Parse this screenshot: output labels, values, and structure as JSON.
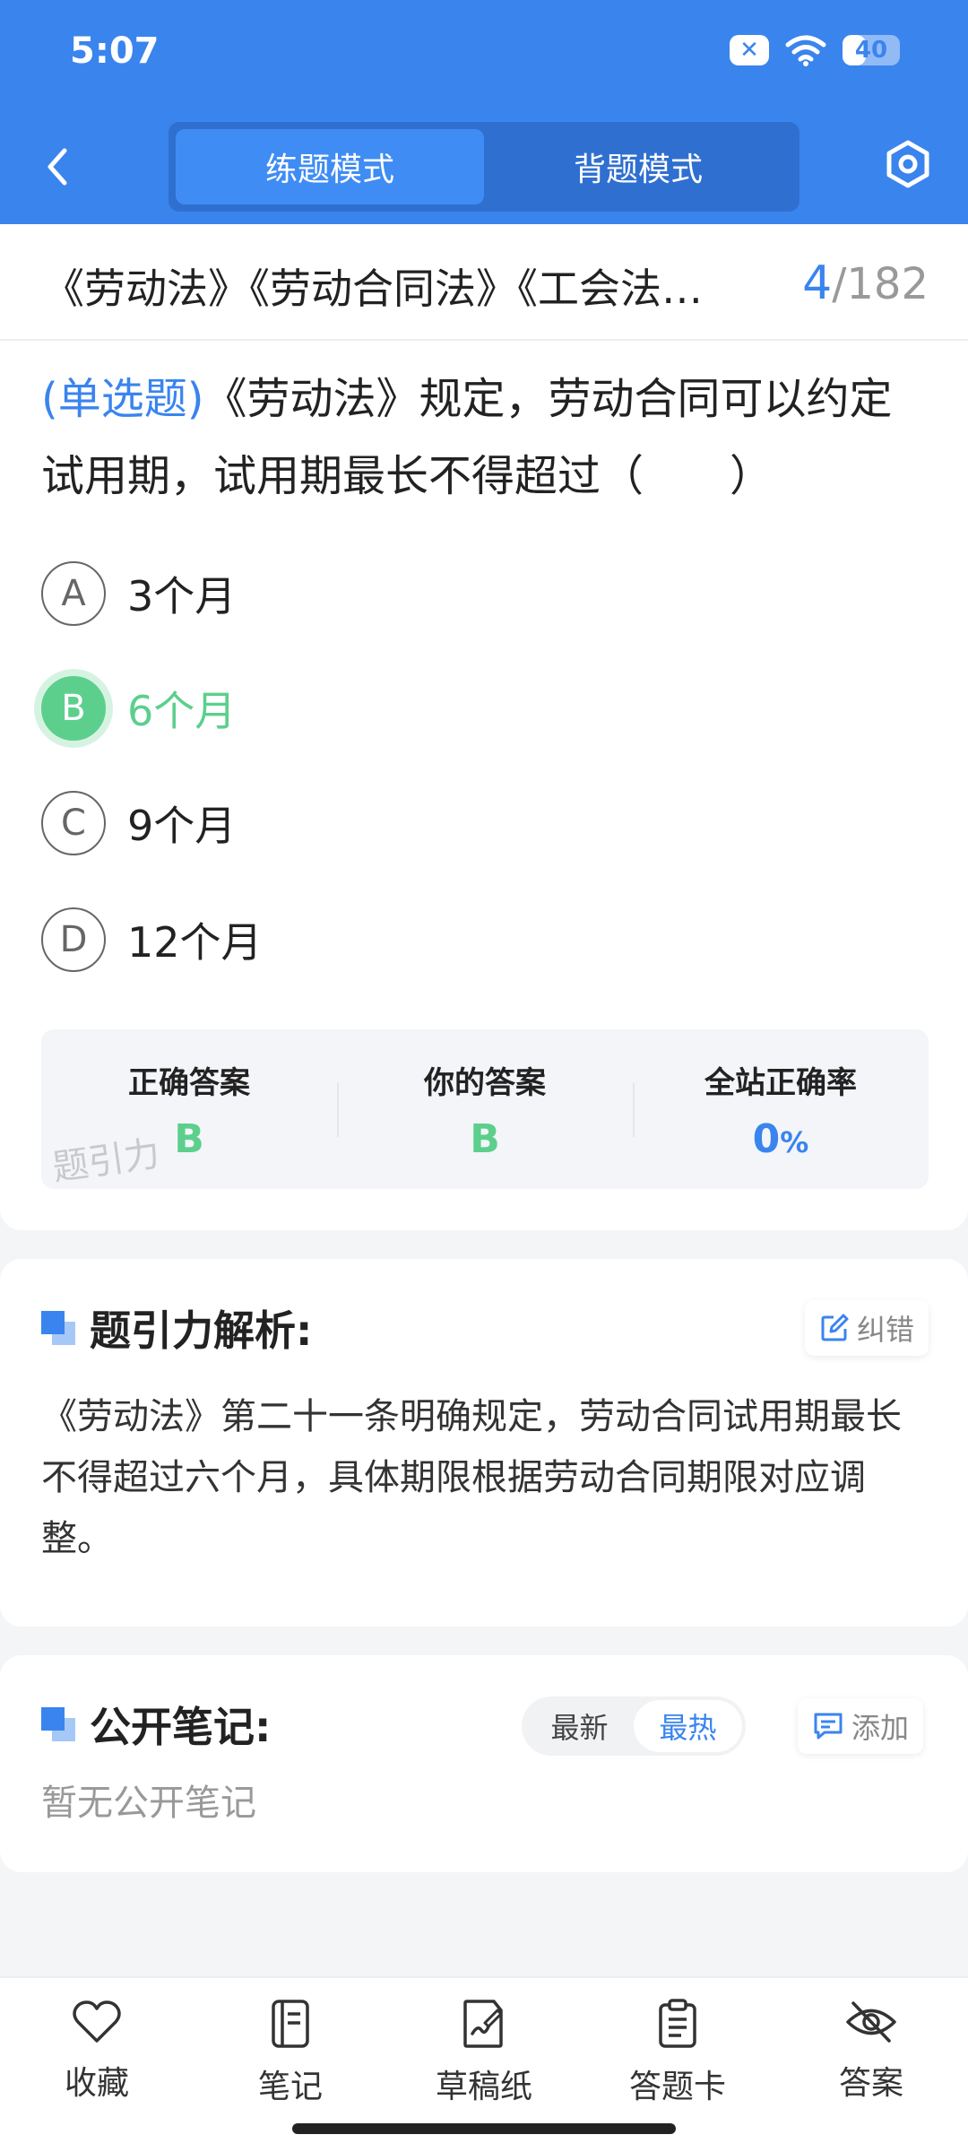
{
  "status_bar": {
    "time": "5:07",
    "battery": "40",
    "battery_level_percent": 40,
    "notification_icon": "x-badge-icon"
  },
  "header": {
    "tabs": [
      {
        "label": "练题模式",
        "active": true
      },
      {
        "label": "背题模式",
        "active": false
      }
    ],
    "back_icon": "chevron-left-icon",
    "settings_icon": "hexagon-settings-icon"
  },
  "chapter": {
    "title": "《劳动法》《劳动合同法》《工会法…",
    "current": "4",
    "total": "/182"
  },
  "question": {
    "type_label": "(单选题)",
    "text": "《劳动法》规定，劳动合同可以约定试用期，试用期最长不得超过（　　）"
  },
  "options": [
    {
      "letter": "A",
      "text": "3个月",
      "state": "normal"
    },
    {
      "letter": "B",
      "text": "6个月",
      "state": "correct"
    },
    {
      "letter": "C",
      "text": "9个月",
      "state": "normal"
    },
    {
      "letter": "D",
      "text": "12个月",
      "state": "normal"
    }
  ],
  "stats": {
    "correct_label": "正确答案",
    "correct_value": "B",
    "yours_label": "你的答案",
    "yours_value": "B",
    "rate_label": "全站正确率",
    "rate_value": "0",
    "rate_unit": "%",
    "watermark": "题引力"
  },
  "analysis": {
    "title": "题引力解析:",
    "report_label": "纠错",
    "text": "《劳动法》第二十一条明确规定，劳动合同试用期最长不得超过六个月，具体期限根据劳动合同期限对应调整。"
  },
  "notes": {
    "title": "公开笔记:",
    "sort_options": [
      {
        "label": "最新",
        "active": false
      },
      {
        "label": "最热",
        "active": true
      }
    ],
    "add_label": "添加",
    "empty_text": "暂无公开笔记"
  },
  "bottom_nav": [
    {
      "label": "收藏",
      "icon": "heart-icon"
    },
    {
      "label": "笔记",
      "icon": "notebook-icon"
    },
    {
      "label": "草稿纸",
      "icon": "draft-paper-icon"
    },
    {
      "label": "答题卡",
      "icon": "answer-sheet-icon"
    },
    {
      "label": "答案",
      "icon": "eye-off-icon"
    }
  ],
  "colors": {
    "primary": "#3a84ee",
    "correct": "#5ccf8d"
  }
}
